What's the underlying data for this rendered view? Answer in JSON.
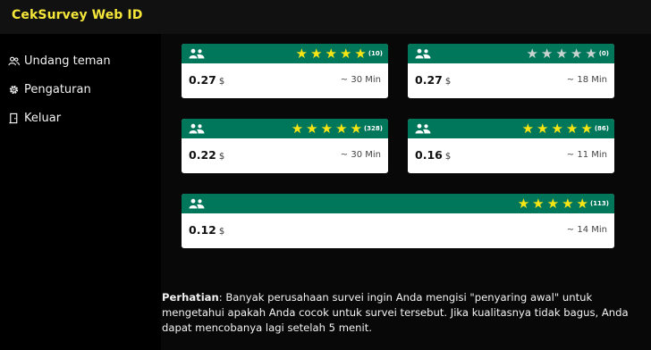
{
  "app": {
    "title": "CekSurvey Web ID"
  },
  "sidebar": {
    "items": [
      {
        "label": "Undang teman",
        "icon": "users-icon"
      },
      {
        "label": "Pengaturan",
        "icon": "gear-icon"
      },
      {
        "label": "Keluar",
        "icon": "logout-icon"
      }
    ]
  },
  "colors": {
    "brand_yellow": "#f5e63a",
    "card_header_green": "#00765a",
    "star_on": "#f7e514",
    "star_off": "#c9d3d0",
    "background": "#080808"
  },
  "surveys": [
    {
      "amount": "0.27",
      "currency": "$",
      "duration": "~ 30 Min",
      "rating": 5,
      "reviews": "(10)"
    },
    {
      "amount": "0.27",
      "currency": "$",
      "duration": "~ 18 Min",
      "rating": 0,
      "reviews": "(0)"
    },
    {
      "amount": "0.22",
      "currency": "$",
      "duration": "~ 30 Min",
      "rating": 5,
      "reviews": "(328)"
    },
    {
      "amount": "0.16",
      "currency": "$",
      "duration": "~ 11 Min",
      "rating": 5,
      "reviews": "(86)"
    },
    {
      "amount": "0.12",
      "currency": "$",
      "duration": "~ 14 Min",
      "rating": 5,
      "reviews": "(113)"
    }
  ],
  "notice": {
    "label": "Perhatian",
    "text": ": Banyak perusahaan survei ingin Anda mengisi \"penyaring awal\" untuk mengetahui apakah Anda cocok untuk survei tersebut. Jika kualitasnya tidak bagus, Anda dapat mencobanya lagi setelah 5 menit."
  }
}
